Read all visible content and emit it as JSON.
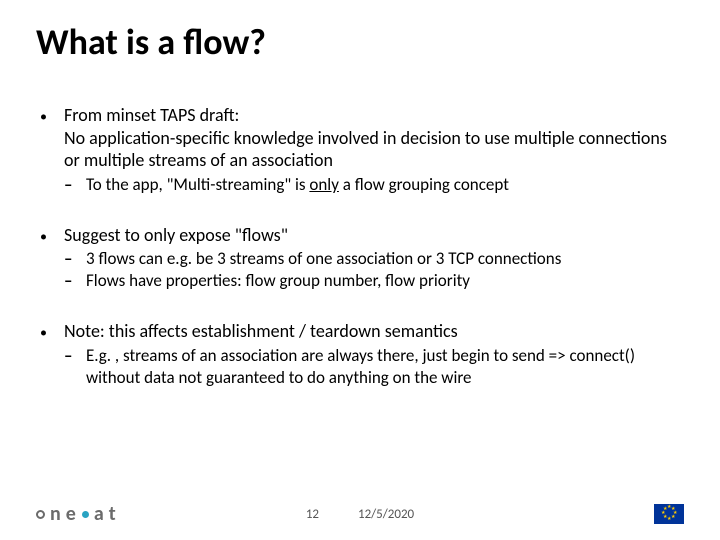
{
  "title": "What is a flow?",
  "bullets": [
    {
      "text": "From minset TAPS draft:",
      "continuation": "No application-specific knowledge involved in decision to use multiple connections or multiple streams of an association",
      "sub": [
        {
          "prefix": "To the app, \"Multi-streaming\" is ",
          "underline": "only",
          "suffix": " a flow grouping concept"
        }
      ]
    },
    {
      "text": "Suggest to only expose \"flows\"",
      "sub": [
        {
          "text": "3 flows can e.g. be 3 streams of one association or 3 TCP connections"
        },
        {
          "text": "Flows have properties: flow group number, flow priority"
        }
      ]
    },
    {
      "text": "Note: this affects establishment / teardown semantics",
      "sub": [
        {
          "text": "E.g. , streams of an association are always there, just begin to send => connect() without data not guaranteed to do anything on the wire"
        }
      ]
    }
  ],
  "footer": {
    "logo_text": "neat",
    "page_number": "12",
    "date": "12/5/2020"
  }
}
